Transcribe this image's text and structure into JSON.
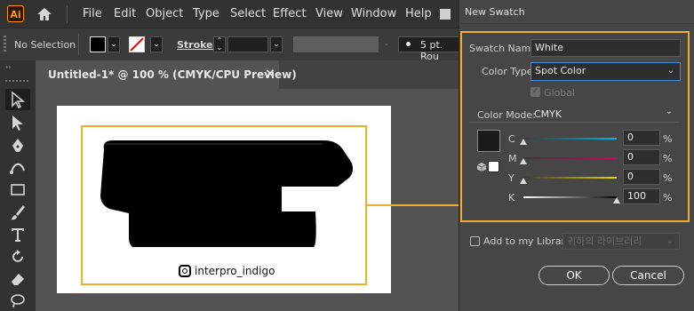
{
  "menu": {
    "items": [
      "File",
      "Edit",
      "Object",
      "Type",
      "Select",
      "Effect",
      "View",
      "Window",
      "Help"
    ]
  },
  "control_bar": {
    "selection": "No Selection",
    "stroke_label": "Stroke:",
    "brush": "5 pt. Rou"
  },
  "document": {
    "tab_title": "Untitled-1* @ 100 % (CMYK/CPU Preview)",
    "close_glyph": "×"
  },
  "artwork": {
    "caption": "interpro_indigo"
  },
  "dialog": {
    "title": "New Swatch",
    "swatch_name_label": "Swatch Name:",
    "swatch_name_value": "White",
    "color_type_label": "Color Type:",
    "color_type_value": "Spot Color",
    "global_label": "Global",
    "color_mode_label": "Color Mode:",
    "color_mode_value": "CMYK",
    "channels": [
      {
        "label": "C",
        "value": "0",
        "percent": 0,
        "unit": "%"
      },
      {
        "label": "M",
        "value": "0",
        "percent": 0,
        "unit": "%"
      },
      {
        "label": "Y",
        "value": "0",
        "percent": 0,
        "unit": "%"
      },
      {
        "label": "K",
        "value": "100",
        "percent": 100,
        "unit": "%"
      }
    ],
    "add_library_label": "Add to my Library",
    "library_value": "귀하의 라이브러리",
    "ok_label": "OK",
    "cancel_label": "Cancel"
  },
  "colors": {
    "accent": "#f2ad2d",
    "app_dark": "#323232",
    "canvas": "#535353",
    "dialog_bg": "#464646"
  }
}
